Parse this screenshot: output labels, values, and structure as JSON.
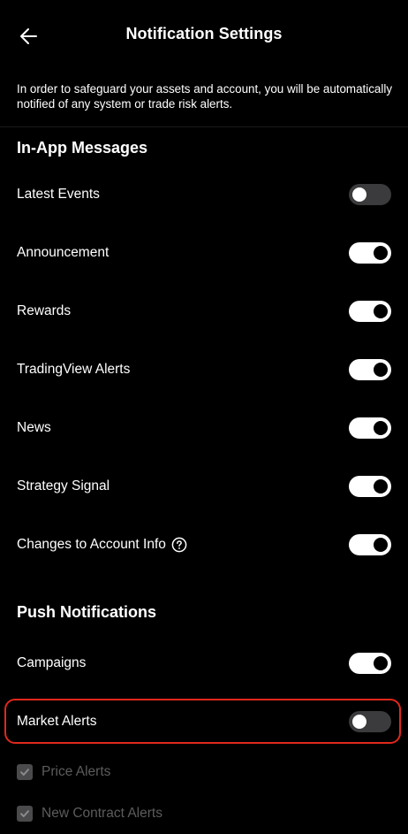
{
  "header": {
    "title": "Notification Settings"
  },
  "intro": {
    "text": "In order to safeguard your assets and account, you will be automatically notified of any system or trade risk alerts."
  },
  "in_app": {
    "title": "In-App Messages",
    "items": [
      {
        "label": "Latest Events",
        "enabled": false
      },
      {
        "label": "Announcement",
        "enabled": true
      },
      {
        "label": "Rewards",
        "enabled": true
      },
      {
        "label": "TradingView Alerts",
        "enabled": true
      },
      {
        "label": "News",
        "enabled": true
      },
      {
        "label": "Strategy Signal",
        "enabled": true
      },
      {
        "label": "Changes to Account Info",
        "enabled": true
      }
    ]
  },
  "push": {
    "title": "Push Notifications",
    "items": [
      {
        "label": "Campaigns",
        "enabled": true
      },
      {
        "label": "Market Alerts",
        "enabled": false
      }
    ],
    "sub_items": [
      {
        "label": "Price Alerts",
        "checked": true,
        "disabled": true
      },
      {
        "label": "New Contract Alerts",
        "checked": true,
        "disabled": true
      }
    ]
  },
  "colors": {
    "background": "#000000",
    "toggle_on": "#ffffff",
    "toggle_off": "#3b3b3d",
    "highlight": "#e0281c",
    "disabled_text": "#5c5c5e"
  },
  "icons": {
    "back": "arrow-left-icon",
    "help": "question-circle-icon",
    "check": "checkmark-icon"
  }
}
